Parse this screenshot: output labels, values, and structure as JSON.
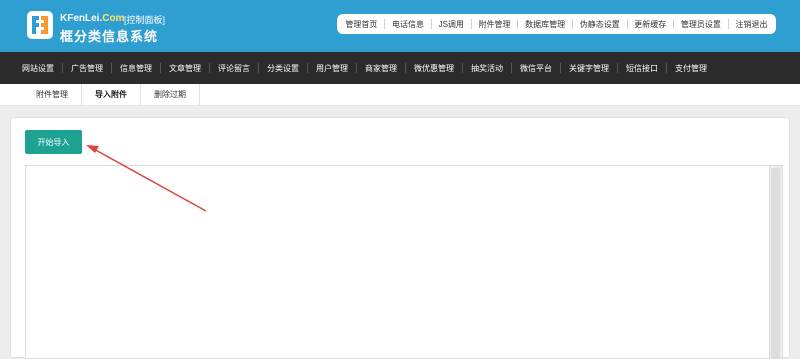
{
  "header": {
    "domain_main": "KFenLei.",
    "domain_com": "Com",
    "badge": "[控制面板]",
    "title": "框分类信息系统"
  },
  "topnav": {
    "items": [
      {
        "label": "管理首页"
      },
      {
        "label": "电话信息"
      },
      {
        "label": "JS调用"
      },
      {
        "label": "附件管理"
      },
      {
        "label": "数据库管理"
      },
      {
        "label": "伪静态设置"
      },
      {
        "label": "更新缓存"
      },
      {
        "label": "管理员设置"
      },
      {
        "label": "注销退出"
      }
    ]
  },
  "mainnav": {
    "items": [
      {
        "label": "网站设置"
      },
      {
        "label": "广告管理"
      },
      {
        "label": "信息管理"
      },
      {
        "label": "文章管理"
      },
      {
        "label": "评论留言"
      },
      {
        "label": "分类设置"
      },
      {
        "label": "用户管理"
      },
      {
        "label": "商家管理"
      },
      {
        "label": "微优惠管理"
      },
      {
        "label": "抽奖活动"
      },
      {
        "label": "微信平台"
      },
      {
        "label": "关键字管理"
      },
      {
        "label": "短信接口"
      },
      {
        "label": "支付管理"
      }
    ]
  },
  "subnav": {
    "tabs": [
      {
        "label": "附件管理",
        "active": false
      },
      {
        "label": "导入附件",
        "active": true
      },
      {
        "label": "删除过期",
        "active": false
      }
    ]
  },
  "content": {
    "start_button": "开始导入"
  },
  "colors": {
    "header_bg": "#2f9fd1",
    "nav_bg": "#2b2b2b",
    "button_bg": "#1ea393",
    "annotation_arrow": "#d9473f"
  }
}
